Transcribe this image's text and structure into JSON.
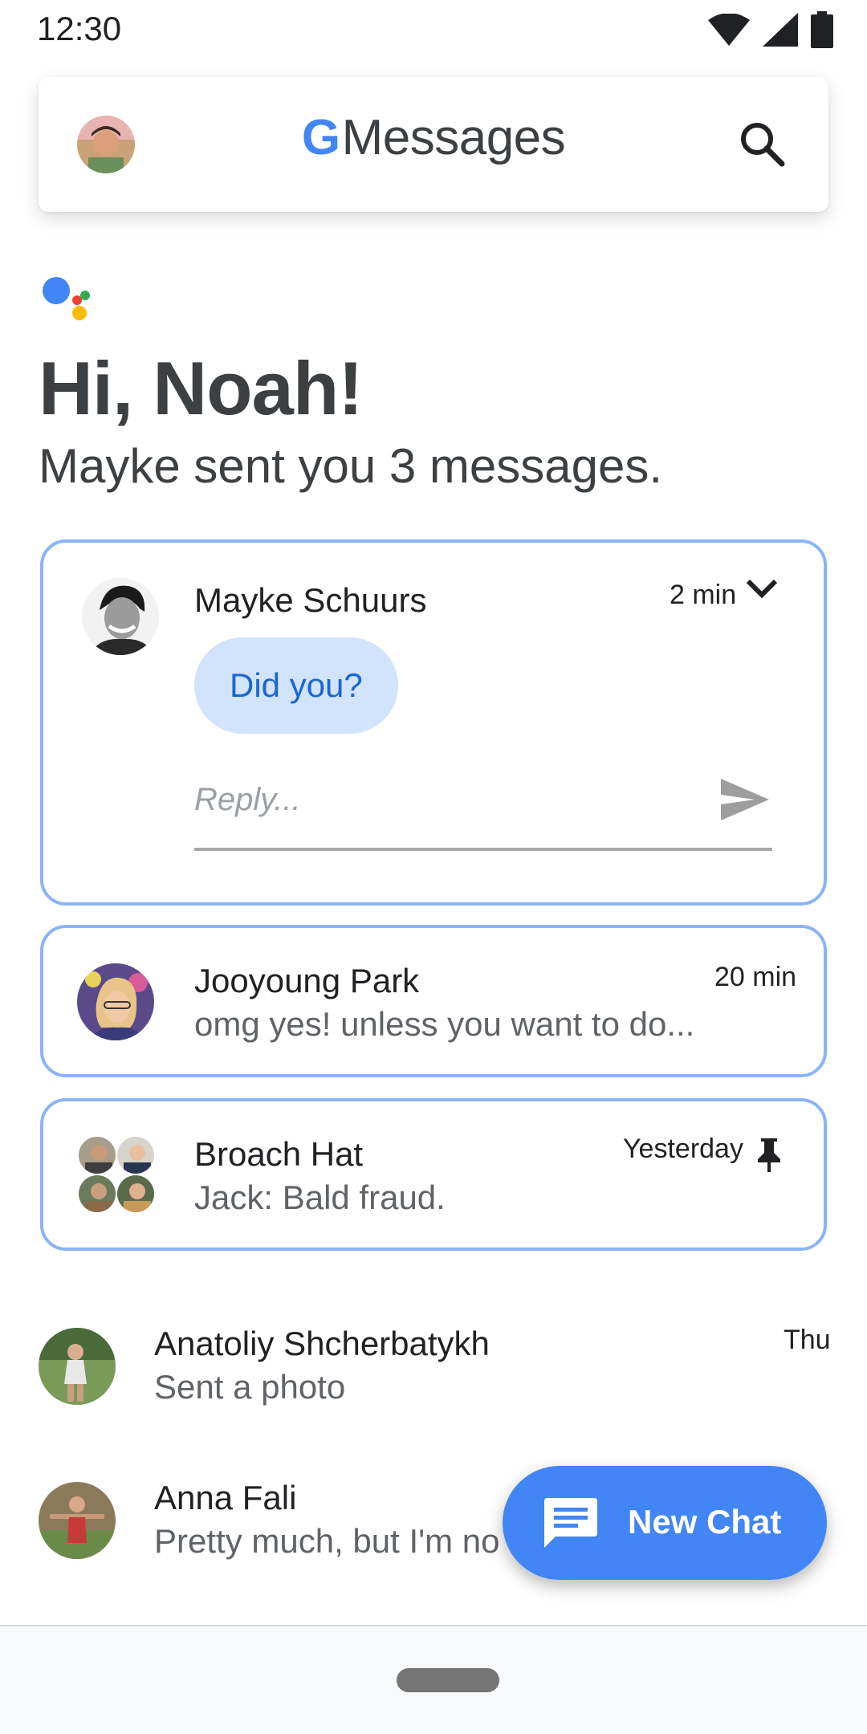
{
  "status_bar": {
    "time": "12:30"
  },
  "app_bar": {
    "logo_letter": "G",
    "title": "Messages"
  },
  "greeting": {
    "title": "Hi, Noah!",
    "subtitle": "Mayke sent you 3 messages."
  },
  "expanded_card": {
    "name": "Mayke Schuurs",
    "time": "2 min",
    "message": "Did you?",
    "reply_placeholder": "Reply..."
  },
  "conversations": [
    {
      "name": "Jooyoung Park",
      "time": "20 min",
      "preview": "omg yes! unless you want to do..."
    },
    {
      "name": "Broach Hat",
      "time": "Yesterday",
      "preview": "Jack: Bald fraud.",
      "pinned": true
    }
  ],
  "list": [
    {
      "name": "Anatoliy Shcherbatykh",
      "time": "Thu",
      "preview": "Sent a photo"
    },
    {
      "name": "Anna Fali",
      "time": "",
      "preview": "Pretty much, but I'm no"
    }
  ],
  "fab": {
    "label": "New Chat"
  },
  "colors": {
    "accent": "#4285f4",
    "card_border": "#8ab4f8",
    "bubble": "#d2e3fc",
    "bubble_text": "#1967d2"
  }
}
